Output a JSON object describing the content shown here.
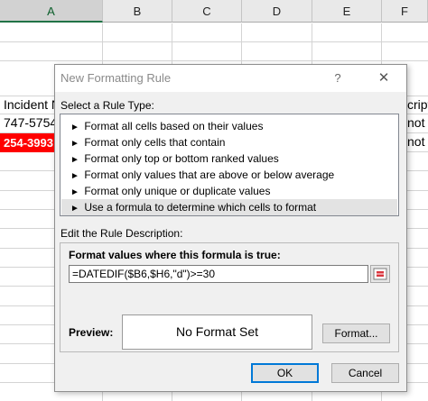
{
  "spreadsheet": {
    "columns": [
      "A",
      "B",
      "C",
      "D",
      "E",
      "F"
    ],
    "selected_column": "A",
    "cells": {
      "a_header": "Incident N",
      "a_row1": "747-5754",
      "a_row2": "254-3993",
      "f_header": "cript",
      "f_row1": "not",
      "f_row2": "not"
    },
    "highlight_color": "#ff0000"
  },
  "dialog": {
    "title": "New Formatting Rule",
    "help_glyph": "?",
    "close_glyph": "✕",
    "rule_type_label": "Select a Rule Type:",
    "rule_types": [
      "Format all cells based on their values",
      "Format only cells that contain",
      "Format only top or bottom ranked values",
      "Format only values that are above or below average",
      "Format only unique or duplicate values",
      "Use a formula to determine which cells to format"
    ],
    "selected_rule_index": 5,
    "rule_arrow": "►",
    "edit_label": "Edit the Rule Description:",
    "formula_label": "Format values where this formula is true:",
    "formula_value": "=DATEDIF($B6,$H6,\"d\")>=30",
    "preview_label": "Preview:",
    "preview_text": "No Format Set",
    "format_button": "Format...",
    "ok_button": "OK",
    "cancel_button": "Cancel"
  }
}
